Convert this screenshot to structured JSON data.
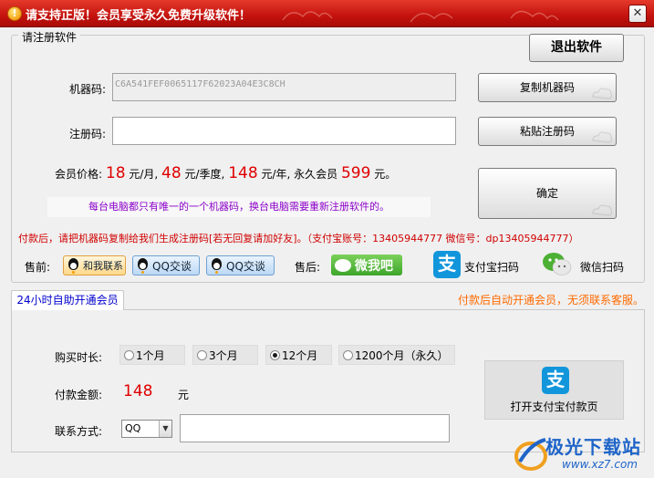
{
  "window": {
    "title": "请支持正版！会员享受永久免费升级软件！",
    "close_glyph": "✕"
  },
  "register": {
    "group_title": "请注册软件",
    "exit_button": "退出软件",
    "machine_label": "机器码:",
    "machine_code": "C6A541FEF0065117F62023A04E3C8CH",
    "copy_button": "复制机器码",
    "reg_label": "注册码:",
    "reg_value": "",
    "paste_button": "粘贴注册码",
    "confirm_button": "确定",
    "price_label": "会员价格:",
    "price_month": "18",
    "unit_month": "元/月,",
    "price_quarter": "48",
    "unit_quarter": "元/季度,",
    "price_year": "148",
    "unit_year": "元/年, 永久会员",
    "price_forever": "599",
    "unit_forever": "元。",
    "notice": "每台电脑都只有唯一的一个机器码，换台电脑需要重新注册软件的。",
    "pay_instruction": "付款后，请把机器码复制给我们生成注册码[若无回复请加好友]。（支付宝账号：13405944777   微信号：dp13405944777）"
  },
  "contact": {
    "presale_label": "售前:",
    "contact_us": "和我联系",
    "qq_chat_1": "QQ交谈",
    "qq_chat_2": "QQ交谈",
    "aftersale_label": "售后:",
    "wechat_me": "微我吧",
    "alipay_scan": "支付宝扫码",
    "wechat_scan": "微信扫码"
  },
  "auto": {
    "tab_label": "24小时自助开通会员",
    "note": "付款后自动开通会员，无须联系客服。",
    "duration_label": "购买时长:",
    "options": [
      "1个月",
      "3个月",
      "12个月",
      "1200个月（永久）"
    ],
    "selected_index": 2,
    "amount_label": "付款金额:",
    "amount": "148",
    "amount_unit": "元",
    "contact_label": "联系方式:",
    "contact_type": "QQ",
    "contact_value": "",
    "open_alipay_button": "打开支付宝付款页"
  },
  "watermark": {
    "name": "极光下载站",
    "url": "www.xz7.com"
  },
  "colors": {
    "title_red": "#c4120e",
    "price_red": "#e00000",
    "notice_purple": "#8a00c8",
    "auto_note_orange": "#ff6a00",
    "alipay_blue": "#1296db",
    "wechat_green": "#3ea52b"
  },
  "icons": {
    "warning": "warning-icon",
    "alipay": "alipay-icon",
    "wechat": "wechat-icon",
    "qq": "qq-penguin-icon"
  }
}
